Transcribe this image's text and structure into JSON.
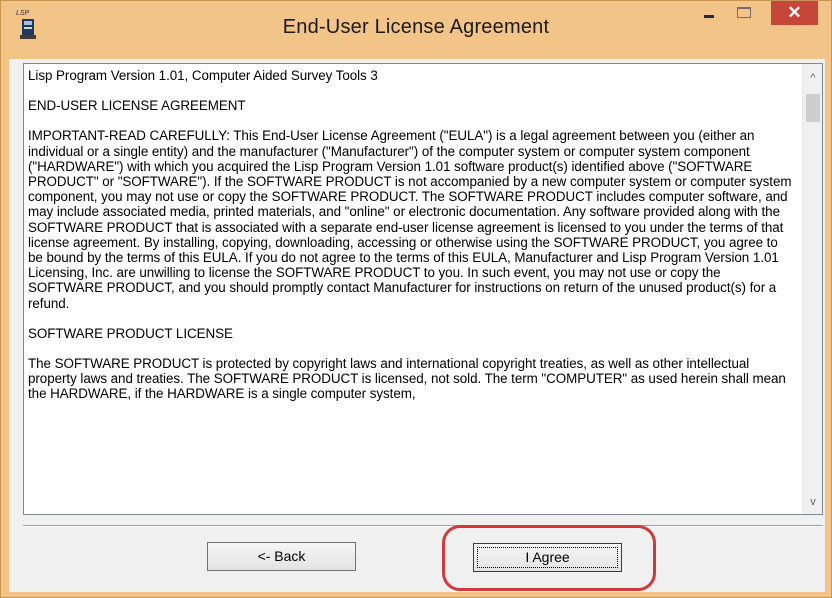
{
  "window": {
    "title": "End-User License Agreement",
    "app_icon_label": "LSP",
    "close_glyph": "✕"
  },
  "license": {
    "paragraphs": [
      "Lisp Program Version 1.01, Computer Aided Survey Tools 3",
      "END-USER LICENSE AGREEMENT",
      "IMPORTANT-READ CAREFULLY: This End-User License Agreement (\"EULA\") is a legal agreement between you (either an individual or a single entity) and the manufacturer (\"Manufacturer\") of the computer system or computer system component (\"HARDWARE\") with which you acquired the Lisp Program Version 1.01 software product(s) identified above (\"SOFTWARE PRODUCT\" or \"SOFTWARE\"). If the SOFTWARE PRODUCT is not accompanied by a new computer system or computer system component, you may not use or copy the SOFTWARE PRODUCT. The SOFTWARE PRODUCT includes computer software, and may include associated media, printed materials, and \"online\" or electronic documentation. Any software provided along with the SOFTWARE PRODUCT that is associated with a separate end-user license agreement is licensed to you under the terms of that license agreement. By installing, copying, downloading, accessing or otherwise using the SOFTWARE PRODUCT, you agree to be bound by the terms of this EULA.  If you do not agree to the terms of this EULA, Manufacturer and Lisp Program Version 1.01 Licensing, Inc. are unwilling to license the SOFTWARE PRODUCT to you. In such event, you may not use or copy the SOFTWARE PRODUCT, and you should promptly contact Manufacturer for instructions on return of the unused product(s) for a refund.",
      "SOFTWARE PRODUCT LICENSE",
      "The SOFTWARE PRODUCT is protected by copyright laws and international copyright treaties, as well as other intellectual property laws and treaties. The SOFTWARE PRODUCT is licensed, not sold. The term \"COMPUTER\" as used herein shall mean the HARDWARE, if the HARDWARE is a single computer system,"
    ]
  },
  "buttons": {
    "back_label": "<- Back",
    "agree_label": "I Agree"
  },
  "scrollbar": {
    "up_glyph": "^",
    "down_glyph": "v"
  },
  "colors": {
    "titlebar": "#f2c488",
    "close_button": "#c7463a",
    "highlight_ring": "#cf3a3a"
  }
}
